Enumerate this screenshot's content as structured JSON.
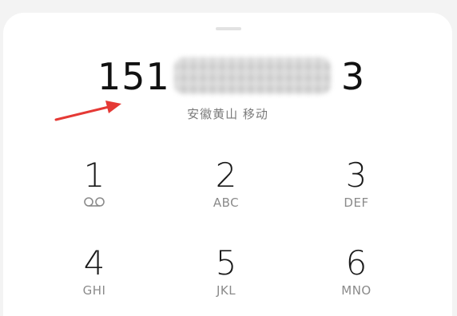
{
  "dialer": {
    "number_prefix": "151",
    "number_suffix": "3",
    "location": "安徽黄山 移动"
  },
  "keypad": [
    {
      "digit": "1",
      "letters": "",
      "icon": "voicemail-icon"
    },
    {
      "digit": "2",
      "letters": "ABC"
    },
    {
      "digit": "3",
      "letters": "DEF"
    },
    {
      "digit": "4",
      "letters": "GHI"
    },
    {
      "digit": "5",
      "letters": "JKL"
    },
    {
      "digit": "6",
      "letters": "MNO"
    }
  ],
  "colors": {
    "arrow": "#e53935",
    "digit": "#1a1a1a",
    "subtext": "#8a8a8a"
  }
}
